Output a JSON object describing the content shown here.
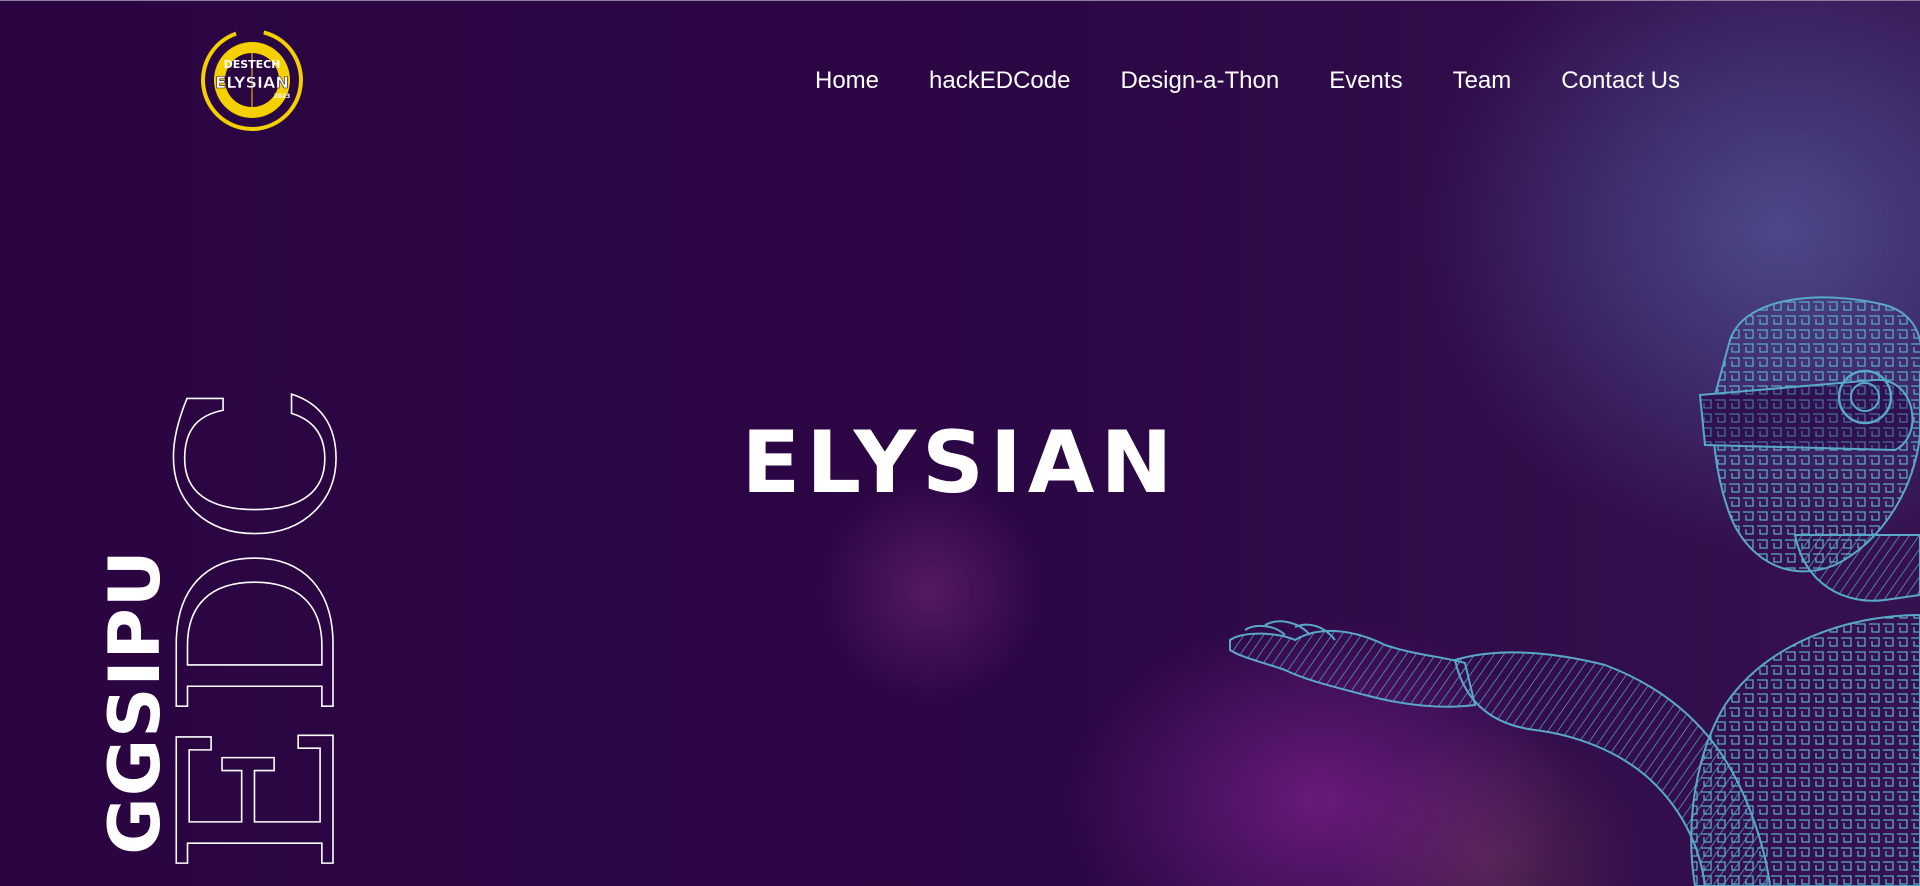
{
  "logo": {
    "top_text": "DESTECH",
    "main_text": "ELYSIAN",
    "sub_text": "2023",
    "colors": {
      "ring": "#f5d000",
      "inner": "#f5d000",
      "text": "#ffffff"
    }
  },
  "nav": {
    "items": [
      {
        "label": "Home"
      },
      {
        "label": "hackEDCode"
      },
      {
        "label": "Design-a-Thon"
      },
      {
        "label": "Events"
      },
      {
        "label": "Team"
      },
      {
        "label": "Contact Us"
      }
    ]
  },
  "hero": {
    "title": "ELYSIAN",
    "vertical_bold": "GGSIPU",
    "vertical_outline": "EDC"
  },
  "colors": {
    "background": "#2a0642",
    "accent_blue": "#5aa8c8",
    "glow_purple": "#962aa0",
    "text": "#ffffff"
  },
  "icons": {
    "robot": "robot-wireframe-illustration"
  }
}
